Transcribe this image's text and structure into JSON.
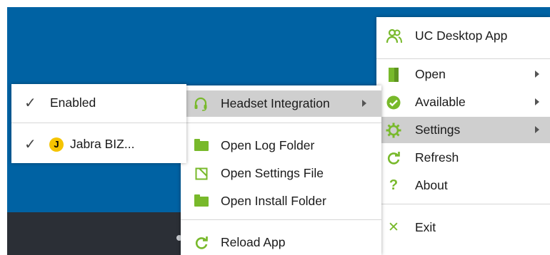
{
  "colors": {
    "desktop": "#0062a3",
    "taskbar": "#2b2f36",
    "accent_green": "#78b92b",
    "highlight": "#cfcfcf"
  },
  "taskbar": {
    "trailing_text": "P"
  },
  "main_menu": {
    "items": [
      {
        "label": "UC Desktop App",
        "icon": "users-icon"
      },
      {
        "label": "Open",
        "icon": "door-icon",
        "submenu": true
      },
      {
        "label": "Available",
        "icon": "check-circle-icon",
        "submenu": true
      },
      {
        "label": "Settings",
        "icon": "gear-icon",
        "submenu": true,
        "highlighted": true
      },
      {
        "label": "Refresh",
        "icon": "refresh-icon"
      },
      {
        "label": "About",
        "icon": "question-icon"
      },
      {
        "label": "Exit",
        "icon": "close-icon"
      }
    ]
  },
  "integration_menu": {
    "items": [
      {
        "label": "Headset Integration",
        "icon": "headset-icon",
        "submenu": true,
        "highlighted": true
      },
      {
        "label": "Open Log Folder",
        "icon": "folder-icon"
      },
      {
        "label": "Open Settings File",
        "icon": "file-icon"
      },
      {
        "label": "Open Install Folder",
        "icon": "folder-icon"
      },
      {
        "label": "Reload App",
        "icon": "reload-icon"
      }
    ]
  },
  "device_menu": {
    "items": [
      {
        "label": "Enabled",
        "checked": true
      },
      {
        "label": "Jabra BIZ...",
        "checked": true,
        "icon": "jabra-logo-icon",
        "logo_letter": "J"
      }
    ]
  }
}
